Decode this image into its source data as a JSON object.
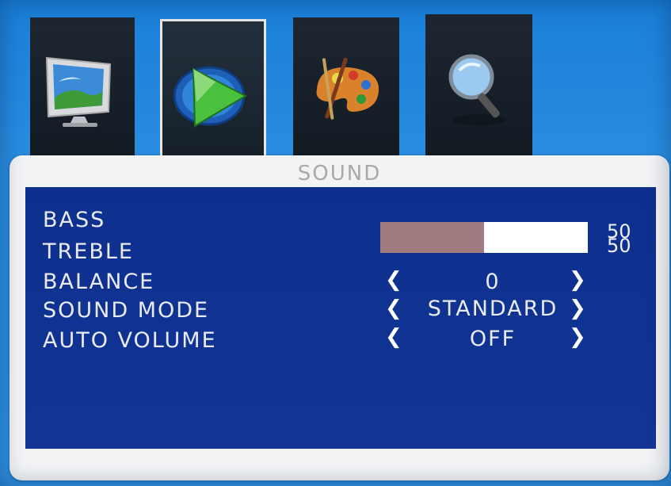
{
  "tabs": [
    {
      "icon": "monitor-icon",
      "selected": false
    },
    {
      "icon": "speaker-play-icon",
      "selected": true
    },
    {
      "icon": "palette-icon",
      "selected": false
    },
    {
      "icon": "magnifier-icon",
      "selected": false
    }
  ],
  "panel": {
    "title": "SOUND",
    "items": {
      "bass": {
        "label": "BASS",
        "value": "50",
        "level": 0.5
      },
      "treble": {
        "label": "TREBLE",
        "value": "50",
        "level": 0.5
      },
      "balance": {
        "label": "BALANCE",
        "value": "0",
        "left_arrow": "❮",
        "right_arrow": "❯"
      },
      "sound_mode": {
        "label": "SOUND MODE",
        "value": "STANDARD",
        "left_arrow": "❮",
        "right_arrow": "❯"
      },
      "auto_volume": {
        "label": "AUTO VOLUME",
        "value": "OFF",
        "left_arrow": "❮",
        "right_arrow": "❯"
      }
    }
  },
  "colors": {
    "background": "#2a8ee0",
    "panel_inner": "#0e2f8d",
    "bar_fill": "#a17c7e",
    "bar_track": "#ffffff"
  }
}
